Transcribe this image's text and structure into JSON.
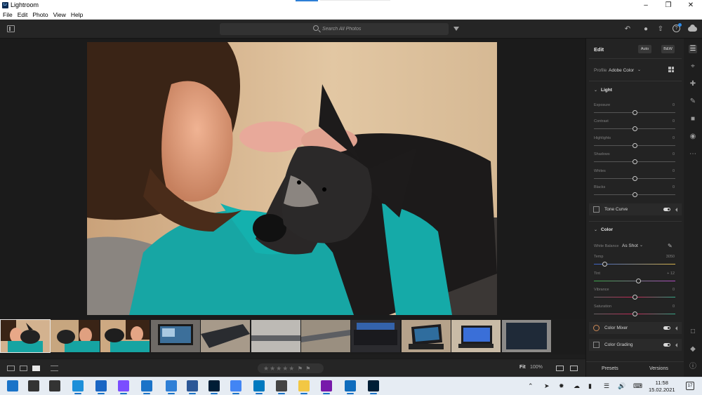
{
  "window": {
    "title": "Lightroom",
    "app_icon_text": "Lr"
  },
  "menu": [
    "File",
    "Edit",
    "Photo",
    "View",
    "Help"
  ],
  "toolbar": {
    "search_placeholder": "Search All Photos"
  },
  "edit_panel": {
    "header": "Edit",
    "auto_label": "Auto",
    "bw_label": "B&W",
    "profile_label": "Profile",
    "profile_value": "Adobe Color",
    "light": {
      "title": "Light",
      "sliders": [
        {
          "label": "Exposure",
          "value": "0",
          "fraction": 0.5
        },
        {
          "label": "Contrast",
          "value": "0",
          "fraction": 0.5
        },
        {
          "label": "Highlights",
          "value": "0",
          "fraction": 0.5
        },
        {
          "label": "Shadows",
          "value": "0",
          "fraction": 0.5
        },
        {
          "label": "Whites",
          "value": "0",
          "fraction": 0.5
        },
        {
          "label": "Blacks",
          "value": "0",
          "fraction": 0.5
        }
      ]
    },
    "tone_curve_label": "Tone Curve",
    "color": {
      "title": "Color",
      "white_balance_label": "White Balance",
      "white_balance_value": "As Shot",
      "sliders": [
        {
          "label": "Temp",
          "value": "3050",
          "fraction": 0.13
        },
        {
          "label": "Tint",
          "value": "+ 12",
          "fraction": 0.55
        },
        {
          "label": "Vibrance",
          "value": "0",
          "fraction": 0.5
        },
        {
          "label": "Saturation",
          "value": "0",
          "fraction": 0.5
        }
      ]
    },
    "color_mixer_label": "Color Mixer",
    "color_grading_label": "Color Grading",
    "presets_label": "Presets",
    "versions_label": "Versions"
  },
  "bottom_bar": {
    "fit_label": "Fit",
    "zoom_value": "100%",
    "stars": "★★★★★"
  },
  "filmstrip": {
    "thumbnails": [
      {
        "subject": "woman-with-dog",
        "selected": true
      },
      {
        "subject": "woman-with-dog"
      },
      {
        "subject": "woman-with-dog"
      },
      {
        "subject": "laptop-screen"
      },
      {
        "subject": "laptop-edge"
      },
      {
        "subject": "laptop-edge-silver"
      },
      {
        "subject": "laptop-edge-silver"
      },
      {
        "subject": "laptop-keyboard"
      },
      {
        "subject": "tablet-with-keyboard"
      },
      {
        "subject": "tablet-screen"
      },
      {
        "subject": "tablet-back"
      }
    ]
  },
  "taskbar": {
    "time": "11:58",
    "date": "15.02.2021",
    "notification_count": "17",
    "pinned_apps": [
      {
        "name": "start",
        "color": "#1a73c8"
      },
      {
        "name": "search",
        "color": "#333333"
      },
      {
        "name": "task-view",
        "color": "#333333"
      },
      {
        "name": "edge",
        "color": "#1c8fd9"
      },
      {
        "name": "mail",
        "color": "#1a66c4"
      },
      {
        "name": "messenger",
        "color": "#7b4dff"
      },
      {
        "name": "chrome-like",
        "color": "#1a73c8"
      },
      {
        "name": "file-explorer-doc",
        "color": "#2f7fd6"
      },
      {
        "name": "word",
        "color": "#2b5797"
      },
      {
        "name": "photoshop",
        "color": "#001e36"
      },
      {
        "name": "translate",
        "color": "#4285f4"
      },
      {
        "name": "trello",
        "color": "#0079bf"
      },
      {
        "name": "calculator",
        "color": "#444444"
      },
      {
        "name": "file-explorer",
        "color": "#f2c744"
      },
      {
        "name": "onenote",
        "color": "#7719aa"
      },
      {
        "name": "outlook",
        "color": "#0f6cbd"
      },
      {
        "name": "lightroom",
        "color": "#001e36"
      }
    ]
  }
}
